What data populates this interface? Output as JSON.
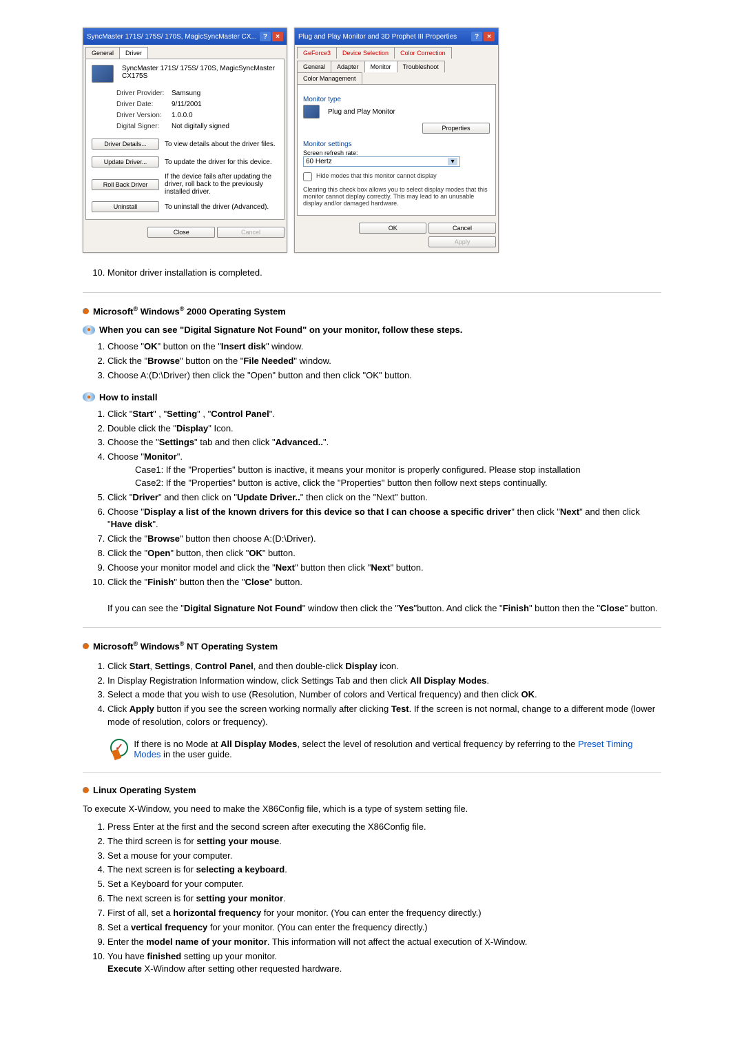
{
  "dialog1": {
    "title": "SyncMaster 171S/ 175S/ 170S, MagicSyncMaster CX...",
    "tab_general": "General",
    "tab_driver": "Driver",
    "desc": "SyncMaster 171S/ 175S/ 170S, MagicSyncMaster CX175S",
    "provider_lbl": "Driver Provider:",
    "provider": "Samsung",
    "date_lbl": "Driver Date:",
    "date": "9/11/2001",
    "version_lbl": "Driver Version:",
    "version": "1.0.0.0",
    "signer_lbl": "Digital Signer:",
    "signer": "Not digitally signed",
    "btn_details": "Driver Details...",
    "details_desc": "To view details about the driver files.",
    "btn_update": "Update Driver...",
    "update_desc": "To update the driver for this device.",
    "btn_rollback": "Roll Back Driver",
    "rollback_desc": "If the device fails after updating the driver, roll back to the previously installed driver.",
    "btn_uninstall": "Uninstall",
    "uninstall_desc": "To uninstall the driver (Advanced).",
    "close": "Close",
    "cancel": "Cancel"
  },
  "dialog2": {
    "title": "Plug and Play Monitor and 3D Prophet III Properties",
    "tab_gef": "GeForce3",
    "tab_devsel": "Device Selection",
    "tab_color": "Color Correction",
    "tab_general": "General",
    "tab_adapter": "Adapter",
    "tab_monitor": "Monitor",
    "tab_trouble": "Troubleshoot",
    "tab_mgmt": "Color Management",
    "mon_type": "Monitor type",
    "mon_name": "Plug and Play Monitor",
    "properties": "Properties",
    "mon_settings": "Monitor settings",
    "refresh_lbl": "Screen refresh rate:",
    "refresh": "60 Hertz",
    "hide": "Hide modes that this monitor cannot display",
    "warn": "Clearing this check box allows you to select display modes that this monitor cannot display correctly. This may lead to an unusable display and/or damaged hardware.",
    "ok": "OK",
    "cancel": "Cancel",
    "apply": "Apply"
  },
  "step10": "Monitor driver installation is completed.",
  "w2000": {
    "header": "Microsoft® Windows® 2000 Operating System",
    "sub1": "When you can see \"Digital Signature Not Found\" on your monitor, follow these steps.",
    "s1": "Choose \"OK\" button on the \"Insert disk\" window.",
    "s2": "Click the \"Browse\" button on the \"File Needed\" window.",
    "s3": "Choose A:(D:\\Driver) then click the \"Open\" button and then click \"OK\" button.",
    "sub2": "How to install",
    "h1": "Click \"Start\" , \"Setting\" , \"Control Panel\".",
    "h2": "Double click the \"Display\" Icon.",
    "h3": "Choose the \"Settings\" tab and then click \"Advanced..\".",
    "h4": "Choose \"Monitor\".",
    "h4c1": "Case1: If the \"Properties\" button is inactive, it means your monitor is properly configured. Please stop installation",
    "h4c2": "Case2: If the \"Properties\" button is active, click the \"Properties\" button then follow next steps continually.",
    "h5": "Click \"Driver\" and then click on \"Update Driver..\" then click on the \"Next\" button.",
    "h6": "Choose \"Display a list of the known drivers for this device so that I can choose a specific driver\" then click \"Next\" and then click \"Have disk\".",
    "h7": "Click the \"Browse\" button then choose A:(D:\\Driver).",
    "h8": "Click the \"Open\" button, then click \"OK\" button.",
    "h9": "Choose your monitor model and click the \"Next\" button then click \"Next\" button.",
    "h10": "Click the \"Finish\" button then the \"Close\" button.",
    "foot": "If you can see the \"Digital Signature Not Found\" window then click the \"Yes\"button. And click the \"Finish\" button then the \"Close\" button."
  },
  "wnt": {
    "header": "Microsoft® Windows® NT Operating System",
    "s1": "Click Start, Settings, Control Panel, and then double-click Display icon.",
    "s2": "In Display Registration Information window, click Settings Tab and then click All Display Modes.",
    "s3": "Select a mode that you wish to use (Resolution, Number of colors and Vertical frequency) and then click OK.",
    "s4": "Click Apply button if you see the screen working normally after clicking Test. If the screen is not normal, change to a different mode (lower mode of resolution, colors or frequency).",
    "note_pre": "If there is no Mode at ",
    "note_b": "All Display Modes",
    "note_mid": ", select the level of resolution and vertical frequency by referring to the ",
    "note_link": "Preset Timing Modes",
    "note_post": " in the user guide."
  },
  "linux": {
    "header": "Linux Operating System",
    "intro": "To execute X-Window, you need to make the X86Config file, which is a type of system setting file.",
    "s1": "Press Enter at the first and the second screen after executing the X86Config file.",
    "s2": "The third screen is for setting your mouse.",
    "s3": "Set a mouse for your computer.",
    "s4": "The next screen is for selecting a keyboard.",
    "s5": "Set a Keyboard for your computer.",
    "s6": "The next screen is for setting your monitor.",
    "s7": "First of all, set a horizontal frequency for your monitor. (You can enter the frequency directly.)",
    "s8": "Set a vertical frequency for your monitor. (You can enter the frequency directly.)",
    "s9": "Enter the model name of your monitor. This information will not affect the actual execution of X-Window.",
    "s10": "You have finished setting up your monitor. Execute X-Window after setting other requested hardware."
  }
}
